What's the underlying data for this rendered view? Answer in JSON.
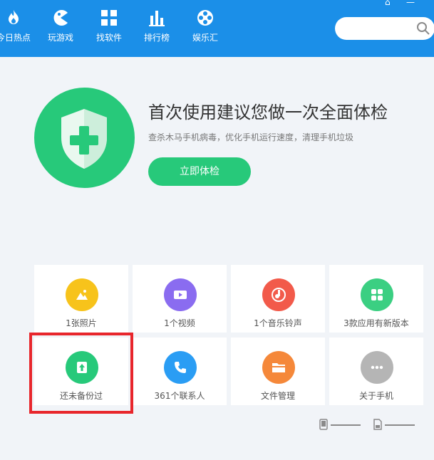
{
  "nav": {
    "items": [
      {
        "label": "今日热点",
        "icon": "flame-icon"
      },
      {
        "label": "玩游戏",
        "icon": "gamepad-icon"
      },
      {
        "label": "找软件",
        "icon": "apps-grid-icon"
      },
      {
        "label": "排行榜",
        "icon": "bar-chart-icon"
      },
      {
        "label": "娱乐汇",
        "icon": "film-reel-icon"
      }
    ],
    "search_placeholder": ""
  },
  "hero": {
    "title": "首次使用建议您做一次全面体检",
    "subtitle": "查杀木马手机病毒，优化手机运行速度，清理手机垃圾",
    "button": "立即体检",
    "icon": "shield-plus-icon"
  },
  "tiles": [
    {
      "label": "1张照片",
      "icon": "photo-icon",
      "color": "#f7c31b"
    },
    {
      "label": "1个视频",
      "icon": "video-icon",
      "color": "#8a6cf0"
    },
    {
      "label": "1个音乐铃声",
      "icon": "music-icon",
      "color": "#f25a4a"
    },
    {
      "label": "3款应用有新版本",
      "icon": "apps-icon",
      "color": "#3bcf82"
    },
    {
      "label": "还未备份过",
      "icon": "backup-icon",
      "color": "#27c97a"
    },
    {
      "label": "361个联系人",
      "icon": "phone-icon",
      "color": "#2a9df4"
    },
    {
      "label": "文件管理",
      "icon": "folder-icon",
      "color": "#f5883a"
    },
    {
      "label": "关于手机",
      "icon": "more-icon",
      "color": "#b5b5b5"
    }
  ],
  "colors": {
    "topbar": "#1b8fe8",
    "accent_green": "#27c97a",
    "highlight_red": "#e8262c",
    "background": "#f1f4f8"
  },
  "storage": {
    "phone_icon": "phone-storage-icon",
    "sd_icon": "sd-card-icon"
  }
}
